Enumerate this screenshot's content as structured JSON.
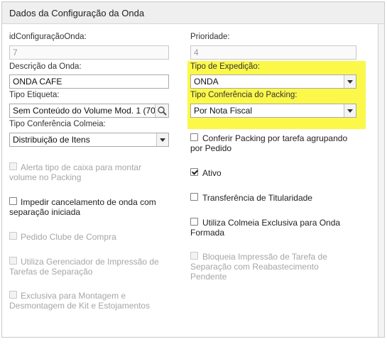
{
  "panel": {
    "title": "Dados da Configuração da Onda"
  },
  "left": {
    "id_label": "idConfiguraçãoOnda:",
    "id_value": "7",
    "descricao_label": "Descrição da Onda:",
    "descricao_value": "ONDA CAFE",
    "etiqueta_label": "Tipo Etiqueta:",
    "etiqueta_value": "Sem Conteúdo do Volume Mod. 1 (70",
    "colmeia_label": "Tipo Conferência Colmeia:",
    "colmeia_value": "Distribuição de Itens"
  },
  "right": {
    "prioridade_label": "Prioridade:",
    "prioridade_value": "4",
    "expedicao_label": "Tipo de Expedição:",
    "expedicao_value": "ONDA",
    "packing_label": "Tipo Conferência do Packing:",
    "packing_value": "Por Nota Fiscal"
  },
  "checkboxes_left": [
    {
      "line1": "Alerta tipo de caixa para montar",
      "line2": "volume no Packing",
      "checked": false,
      "disabled": true
    },
    {
      "line1": "Impedir cancelamento de onda com",
      "line2": "separação iniciada",
      "checked": false,
      "disabled": false
    },
    {
      "line1": "Pedido Clube de Compra",
      "line2": "",
      "checked": false,
      "disabled": true
    },
    {
      "line1": "Utiliza Gerenciador de Impressão de",
      "line2": "Tarefas de Separação",
      "checked": false,
      "disabled": true
    },
    {
      "line1": "Exclusiva para Montagem e",
      "line2": "Desmontagem de Kit e Estojamentos",
      "checked": false,
      "disabled": true
    }
  ],
  "checkboxes_right": [
    {
      "line1": "Conferir Packing por tarefa agrupando",
      "line2": "por Pedido",
      "line3": "",
      "checked": false,
      "disabled": false
    },
    {
      "line1": "Ativo",
      "line2": "",
      "line3": "",
      "checked": true,
      "disabled": false
    },
    {
      "line1": "Transferência de Titularidade",
      "line2": "",
      "line3": "",
      "checked": false,
      "disabled": false
    },
    {
      "line1": "Utiliza Colmeia Exclusiva para Onda",
      "line2": "Formada",
      "line3": "",
      "checked": false,
      "disabled": false
    },
    {
      "line1": "Bloqueia Impressão de Tarefa de",
      "line2": "Separação com Reabastecimento",
      "line3": "Pendente",
      "checked": false,
      "disabled": true
    }
  ],
  "colors": {
    "highlight": "#fbf84a",
    "header_bg": "#efefef",
    "disabled_text": "#a6a6a6"
  }
}
